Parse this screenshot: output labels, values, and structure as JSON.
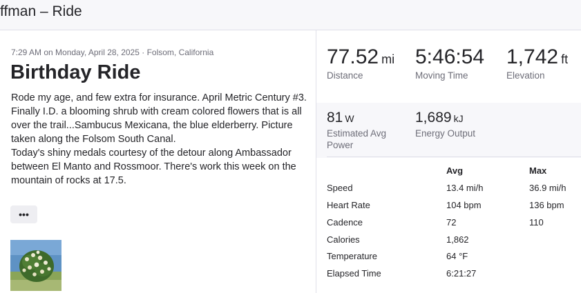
{
  "header": {
    "title": "ffman – Ride"
  },
  "activity": {
    "meta": "7:29 AM on Monday, April 28, 2025 · Folsom, California",
    "title": "Birthday Ride",
    "description_p1": "Rode my age, and few extra for insurance. April Metric Century #3. Finally I.D. a blooming shrub with cream colored flowers that is all over the trail...Sambucus Mexicana, the blue elderberry. Picture taken along the Folsom South Canal.",
    "description_p2": "Today's shiny medals courtesy of the detour along Ambassador between El Manto and Rossmoor. There's work this week on the mountain of rocks at 17.5.",
    "more_label": "•••"
  },
  "primary_stats": [
    {
      "value": "77.52",
      "unit": "mi",
      "label": "Distance"
    },
    {
      "value": "5:46:54",
      "unit": "",
      "label": "Moving Time"
    },
    {
      "value": "1,742",
      "unit": "ft",
      "label": "Elevation"
    }
  ],
  "secondary_stats": [
    {
      "value": "81",
      "unit": "W",
      "label": "Estimated Avg Power"
    },
    {
      "value": "1,689",
      "unit": "kJ",
      "label": "Energy Output"
    }
  ],
  "table": {
    "headers": {
      "avg": "Avg",
      "max": "Max"
    },
    "rows": [
      {
        "label": "Speed",
        "avg": "13.4 mi/h",
        "max": "36.9 mi/h"
      },
      {
        "label": "Heart Rate",
        "avg": "104 bpm",
        "max": "136 bpm"
      },
      {
        "label": "Cadence",
        "avg": "72",
        "max": "110"
      },
      {
        "label": "Calories",
        "avg": "1,862",
        "max": ""
      },
      {
        "label": "Temperature",
        "avg": "64 °F",
        "max": ""
      },
      {
        "label": "Elapsed Time",
        "avg": "6:21:27",
        "max": ""
      }
    ]
  }
}
